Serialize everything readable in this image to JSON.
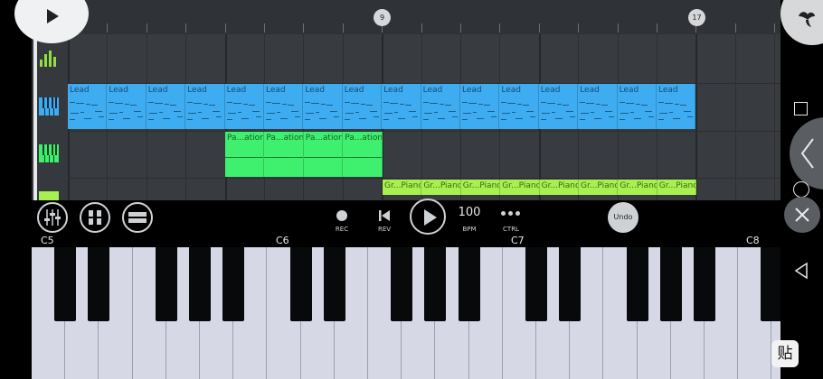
{
  "ruler": {
    "markers": [
      {
        "label": "9"
      },
      {
        "label": "17"
      }
    ]
  },
  "tracks": {
    "lead": {
      "clip_label": "Lead",
      "clip_count": 16
    },
    "pad": {
      "clip_label": "Pa...ation",
      "clip_count": 4
    },
    "piano": {
      "clip_label": "Gr...Piano",
      "clip_count": 8
    }
  },
  "transport": {
    "rec_label": "REC",
    "rev_label": "REV",
    "bpm_value": "100",
    "bpm_label": "BPM",
    "ctrl_label": "CTRL",
    "undo_label": "Undo"
  },
  "keyboard": {
    "octave_labels": [
      "C5",
      "C6",
      "C7",
      "C8"
    ]
  },
  "paste_label": "贴",
  "colors": {
    "lead": "#3eacf0",
    "pad": "#3ef06e",
    "piano": "#a6f050",
    "background": "#383b40"
  }
}
